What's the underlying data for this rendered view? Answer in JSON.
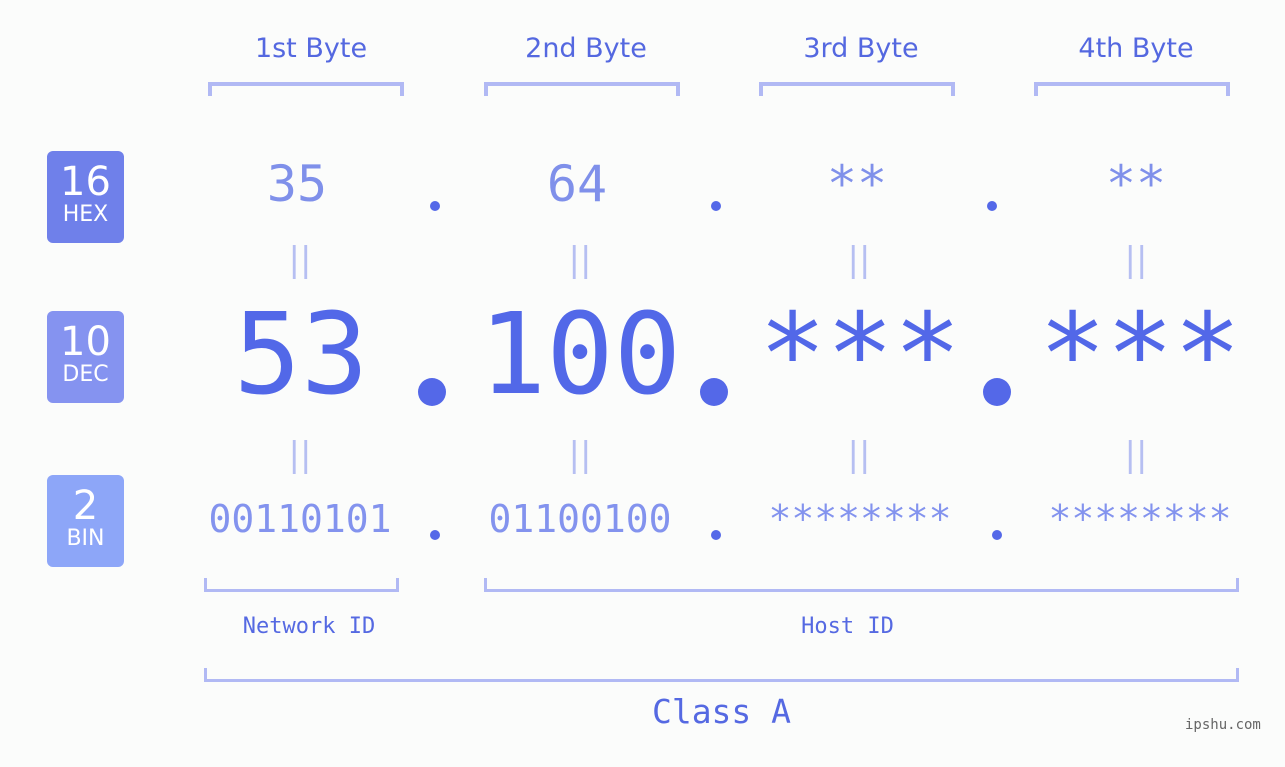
{
  "bytes": [
    {
      "header": "1st Byte",
      "hex": "35",
      "dec": "53",
      "bin": "00110101"
    },
    {
      "header": "2nd Byte",
      "hex": "64",
      "dec": "100",
      "bin": "01100100"
    },
    {
      "header": "3rd Byte",
      "hex": "**",
      "dec": "***",
      "bin": "********"
    },
    {
      "header": "4th Byte",
      "hex": "**",
      "dec": "***",
      "bin": "********"
    }
  ],
  "badges": {
    "hex": {
      "num": "16",
      "label": "HEX",
      "color": "#6f80ea"
    },
    "dec": {
      "num": "10",
      "label": "DEC",
      "color": "#8593f0"
    },
    "bin": {
      "num": "2",
      "label": "BIN",
      "color": "#8da6f8"
    }
  },
  "equals": "||",
  "network_id_label": "Network ID",
  "host_id_label": "Host ID",
  "class_label": "Class A",
  "watermark": "ipshu.com"
}
